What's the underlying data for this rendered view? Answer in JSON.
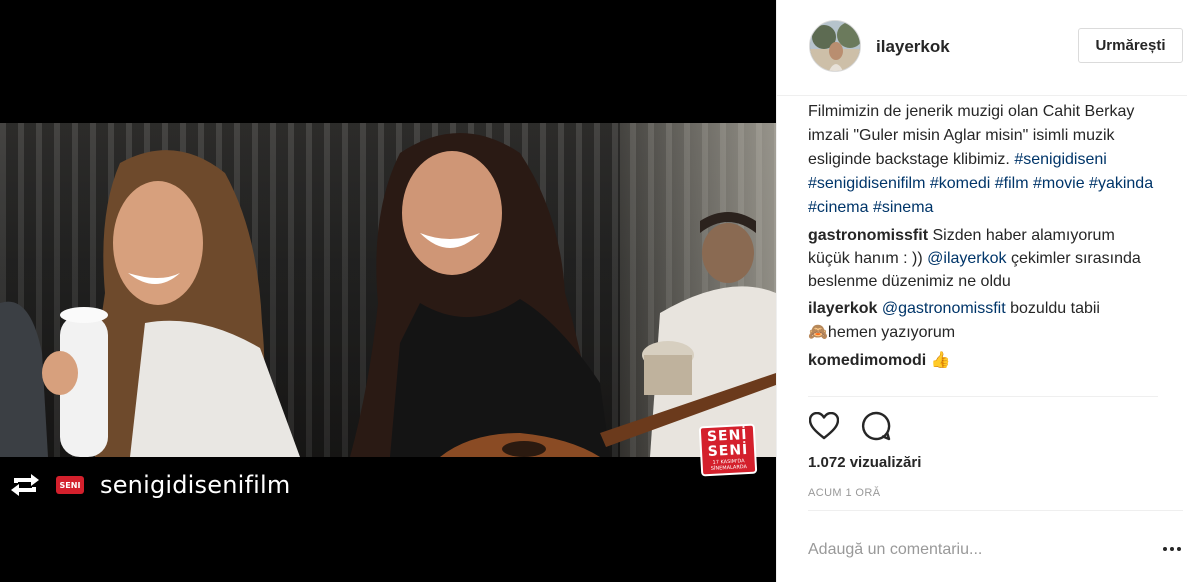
{
  "post": {
    "username": "ilayerkok",
    "follow_label": "Urmărești",
    "repost_username": "senigidisenifilm",
    "mini_logo_text": "SENI",
    "sticker": {
      "line1": "SENİ",
      "line2": "SENİ",
      "line3": "17 KASIM'DA",
      "line4": "SİNEMALARDA"
    }
  },
  "caption": {
    "user": "",
    "text": "Filmimizin de jenerik muzigi olan Cahit Berkay imzali \"Guler misin Aglar misin\" isimli muzik esliginde backstage klibimiz. ",
    "hashtags": [
      "#senigidiseni",
      "#senigidisenifilm",
      "#komedi",
      "#film",
      "#movie",
      "#yakinda",
      "#cinema",
      "#sinema"
    ]
  },
  "comments": [
    {
      "user": "gastronomissfit",
      "text_before": " Sizden haber alamıyorum küçük hanım : )) ",
      "mention": "@ilayerkok",
      "text_after": " çekimler sırasında beslenme düzenimiz ne oldu"
    },
    {
      "user": "ilayerkok",
      "text_before": " ",
      "mention": "@gastronomissfit",
      "text_after": " bozuldu tabii",
      "emoji": "🙈",
      "text_line2": "hemen yazıyorum"
    },
    {
      "user": "komedimomodi",
      "text_before": " ",
      "emoji": "👍"
    }
  ],
  "stats": {
    "views": "1.072 vizualizări",
    "time_ago": "ACUM 1 ORĂ"
  },
  "comment_form": {
    "placeholder": "Adaugă un comentariu..."
  },
  "icons": {
    "repost": "repost-icon",
    "like": "heart-icon",
    "comment": "comment-icon",
    "more": "more-options-icon"
  },
  "colors": {
    "hashtag": "#003569",
    "sticker_red": "#d4202c"
  }
}
